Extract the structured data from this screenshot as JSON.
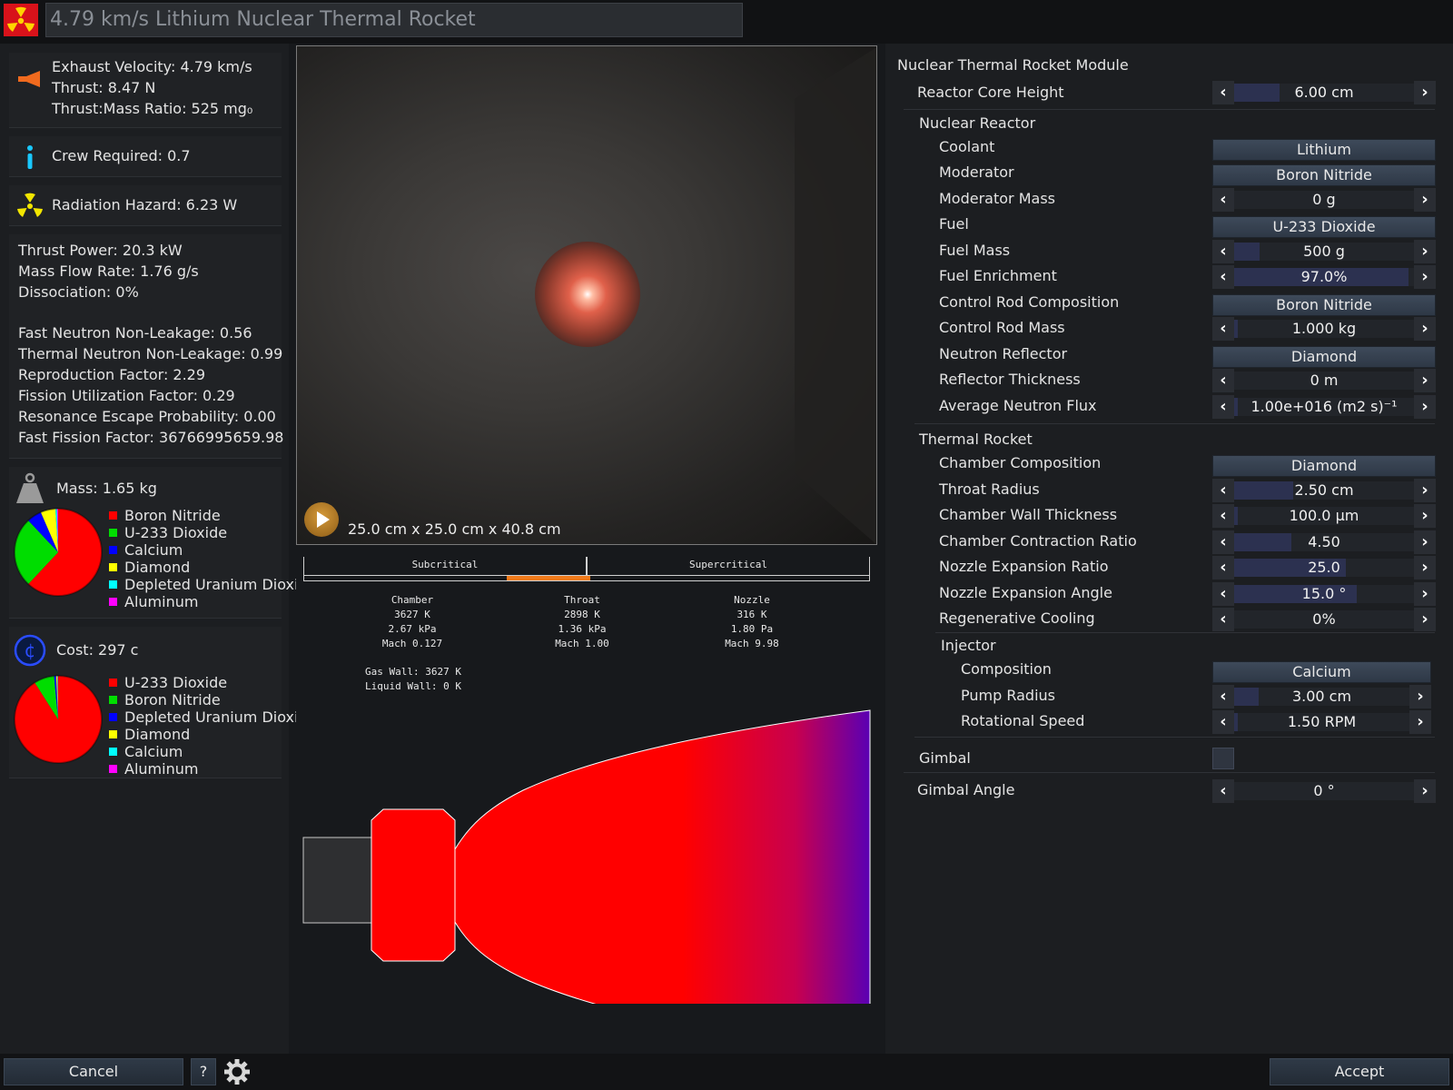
{
  "title": "4.79 km/s Lithium Nuclear Thermal Rocket",
  "left": {
    "exhaust_velocity": "Exhaust Velocity: 4.79 km/s",
    "thrust": "Thrust: 8.47 N",
    "thrust_mass_ratio": "Thrust:Mass Ratio: 525 mg₀",
    "crew_required": "Crew Required: 0.7",
    "radiation_hazard": "Radiation Hazard: 6.23 W",
    "thrust_power": "Thrust Power: 20.3 kW",
    "mass_flow_rate": "Mass Flow Rate: 1.76 g/s",
    "dissociation": "Dissociation: 0%",
    "fast_neutron": "Fast Neutron Non-Leakage: 0.56",
    "thermal_neutron": "Thermal Neutron Non-Leakage: 0.99",
    "reproduction": "Reproduction Factor: 2.29",
    "fission_utilization": "Fission Utilization Factor: 0.29",
    "resonance_escape": "Resonance Escape Probability: 0.00",
    "fast_fission": "Fast Fission Factor: 36766995659.98",
    "mass": "Mass: 1.65 kg",
    "cost": "Cost: 297 c",
    "mass_legend": [
      {
        "label": "Boron Nitride",
        "color": "#ff0000",
        "value": 0.62
      },
      {
        "label": "U-233 Dioxide",
        "color": "#00dd00",
        "value": 0.26
      },
      {
        "label": "Calcium",
        "color": "#0000ff",
        "value": 0.055
      },
      {
        "label": "Diamond",
        "color": "#ffff00",
        "value": 0.055
      },
      {
        "label": "Depleted Uranium Dioxi",
        "color": "#00ffff",
        "value": 0.006
      },
      {
        "label": "Aluminum",
        "color": "#ff00ff",
        "value": 0.004
      }
    ],
    "cost_legend": [
      {
        "label": "U-233 Dioxide",
        "color": "#ff0000",
        "value": 0.91
      },
      {
        "label": "Boron Nitride",
        "color": "#00dd00",
        "value": 0.075
      },
      {
        "label": "Depleted Uranium Dioxi",
        "color": "#0000ff",
        "value": 0.008
      },
      {
        "label": "Diamond",
        "color": "#ffff00",
        "value": 0.004
      },
      {
        "label": "Calcium",
        "color": "#00ffff",
        "value": 0.002
      },
      {
        "label": "Aluminum",
        "color": "#ff00ff",
        "value": 0.001
      }
    ]
  },
  "viewport": {
    "dimensions": "25.0 cm x 25.0 cm x 40.8 cm"
  },
  "criticality": {
    "subcritical": "Subcritical",
    "supercritical": "Supercritical",
    "level": 0.5
  },
  "flow": {
    "chamber": {
      "name": "Chamber",
      "temp": "3627 K",
      "pressure": "2.67 kPa",
      "mach": "Mach 0.127"
    },
    "throat": {
      "name": "Throat",
      "temp": "2898 K",
      "pressure": "1.36 kPa",
      "mach": "Mach 1.00"
    },
    "nozzle": {
      "name": "Nozzle",
      "temp": "316 K",
      "pressure": "1.80 Pa",
      "mach": "Mach 9.98"
    },
    "gas_wall": "Gas Wall: 3627 K",
    "liquid_wall": "Liquid Wall: 0 K"
  },
  "right": {
    "module_title": "Nuclear Thermal Rocket Module",
    "reactor_core_height": {
      "label": "Reactor Core Height",
      "value": "6.00 cm",
      "level": 0.25
    },
    "nuclear_reactor": "Nuclear Reactor",
    "coolant": {
      "label": "Coolant",
      "value": "Lithium"
    },
    "moderator": {
      "label": "Moderator",
      "value": "Boron Nitride"
    },
    "moderator_mass": {
      "label": "Moderator Mass",
      "value": "0 g",
      "level": 0.0
    },
    "fuel": {
      "label": "Fuel",
      "value": "U-233 Dioxide"
    },
    "fuel_mass": {
      "label": "Fuel Mass",
      "value": "500 g",
      "level": 0.14
    },
    "fuel_enrichment": {
      "label": "Fuel Enrichment",
      "value": "97.0%",
      "level": 0.97
    },
    "control_rod_composition": {
      "label": "Control Rod Composition",
      "value": "Boron Nitride"
    },
    "control_rod_mass": {
      "label": "Control Rod Mass",
      "value": "1.000 kg",
      "level": 0.02
    },
    "neutron_reflector": {
      "label": "Neutron Reflector",
      "value": "Diamond"
    },
    "reflector_thickness": {
      "label": "Reflector Thickness",
      "value": "0 m",
      "level": 0.0
    },
    "average_neutron_flux": {
      "label": "Average Neutron Flux",
      "value": "1.00e+016 (m2 s)⁻¹",
      "level": 0.02
    },
    "thermal_rocket": "Thermal Rocket",
    "chamber_composition": {
      "label": "Chamber Composition",
      "value": "Diamond"
    },
    "throat_radius": {
      "label": "Throat Radius",
      "value": "2.50 cm",
      "level": 0.33
    },
    "chamber_wall_thickness": {
      "label": "Chamber Wall Thickness",
      "value": "100.0 µm",
      "level": 0.02
    },
    "chamber_contraction_ratio": {
      "label": "Chamber Contraction Ratio",
      "value": "4.50",
      "level": 0.32
    },
    "nozzle_expansion_ratio": {
      "label": "Nozzle Expansion Ratio",
      "value": "25.0",
      "level": 0.62
    },
    "nozzle_expansion_angle": {
      "label": "Nozzle Expansion Angle",
      "value": "15.0 °",
      "level": 0.68
    },
    "regenerative_cooling": {
      "label": "Regenerative Cooling",
      "value": "0%",
      "level": 0.0
    },
    "injector": "Injector",
    "composition": {
      "label": "Composition",
      "value": "Calcium"
    },
    "pump_radius": {
      "label": "Pump Radius",
      "value": "3.00 cm",
      "level": 0.14
    },
    "rotational_speed": {
      "label": "Rotational Speed",
      "value": "1.50 RPM",
      "level": 0.02
    },
    "gimbal": {
      "label": "Gimbal",
      "checked": false
    },
    "gimbal_angle": {
      "label": "Gimbal Angle",
      "value": "0 °",
      "level": 0.0
    }
  },
  "bottom": {
    "cancel": "Cancel",
    "help": "?",
    "accept": "Accept"
  },
  "colors": {
    "accent_fill": "#2c3150",
    "criticality_bar": "#f07a1a",
    "button": "#36414f"
  }
}
